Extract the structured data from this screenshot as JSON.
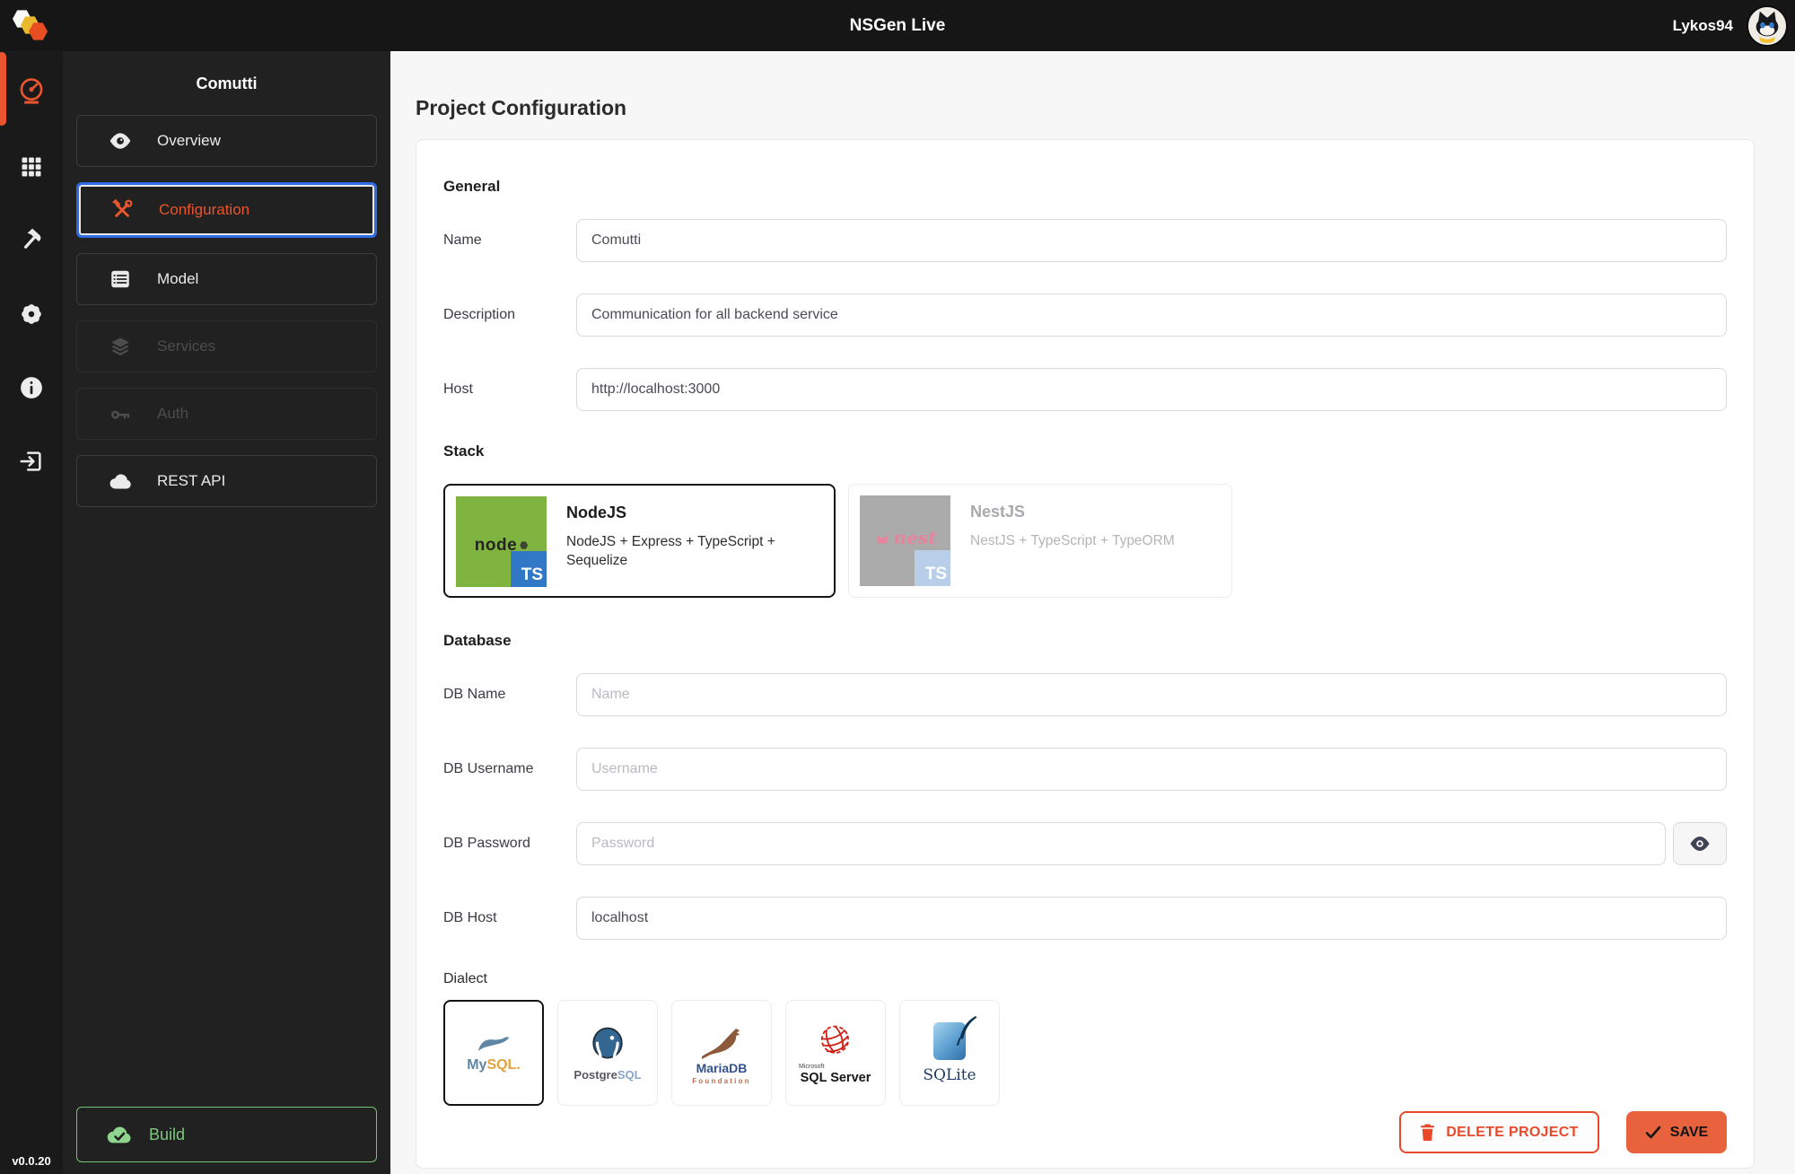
{
  "topbar": {
    "title": "NSGen Live",
    "username": "Lykos94"
  },
  "rail": {
    "version": "v0.0.20",
    "items": [
      {
        "icon": "speedometer",
        "active": true
      },
      {
        "icon": "grid",
        "active": false
      },
      {
        "icon": "hammer",
        "active": false
      },
      {
        "icon": "gear",
        "active": false
      },
      {
        "icon": "info",
        "active": false
      },
      {
        "icon": "sign-out",
        "active": false
      }
    ]
  },
  "sidebar": {
    "project_name": "Comutti",
    "items": [
      {
        "label": "Overview",
        "icon": "eye",
        "state": "normal"
      },
      {
        "label": "Configuration",
        "icon": "tools",
        "state": "active"
      },
      {
        "label": "Model",
        "icon": "list",
        "state": "normal"
      },
      {
        "label": "Services",
        "icon": "layers",
        "state": "disabled"
      },
      {
        "label": "Auth",
        "icon": "key",
        "state": "disabled"
      },
      {
        "label": "REST API",
        "icon": "cloud",
        "state": "normal"
      }
    ],
    "build_label": "Build"
  },
  "main": {
    "page_title": "Project Configuration",
    "sections": {
      "general": {
        "title": "General",
        "fields": [
          {
            "label": "Name",
            "value": "Comutti",
            "placeholder": ""
          },
          {
            "label": "Description",
            "value": "Communication for all backend service",
            "placeholder": ""
          },
          {
            "label": "Host",
            "value": "http://localhost:3000",
            "placeholder": ""
          }
        ]
      },
      "stack": {
        "title": "Stack",
        "options": [
          {
            "name": "NodeJS",
            "description": "NodeJS + Express + TypeScript + Sequelize",
            "logo_text": "node",
            "badge": "TS",
            "selected": true
          },
          {
            "name": "NestJS",
            "description": "NestJS + TypeScript + TypeORM",
            "logo_text": "nest",
            "badge": "TS",
            "selected": false
          }
        ]
      },
      "database": {
        "title": "Database",
        "fields": [
          {
            "label": "DB Name",
            "value": "",
            "placeholder": "Name"
          },
          {
            "label": "DB Username",
            "value": "",
            "placeholder": "Username"
          },
          {
            "label": "DB Password",
            "value": "",
            "placeholder": "Password"
          },
          {
            "label": "DB Host",
            "value": "localhost",
            "placeholder": ""
          }
        ],
        "dialect_label": "Dialect",
        "dialects": [
          {
            "name": "MySQL",
            "selected": true,
            "text_parts": [
              "My",
              "SQL."
            ]
          },
          {
            "name": "PostgreSQL",
            "selected": false,
            "text_parts": [
              "Postgre",
              "SQL"
            ]
          },
          {
            "name": "MariaDB Foundation",
            "selected": false,
            "text_parts": [
              "MariaDB",
              "Foundation"
            ]
          },
          {
            "name": "SQL Server",
            "selected": false,
            "text_parts": [
              "Microsoft",
              "SQL Server"
            ]
          },
          {
            "name": "SQLite",
            "selected": false,
            "text_parts": [
              "SQLite"
            ]
          }
        ]
      }
    },
    "actions": {
      "delete_label": "DELETE PROJECT",
      "save_label": "SAVE"
    }
  },
  "colors": {
    "accent_orange": "#e8552f",
    "save_orange": "#e8623e",
    "delete_red": "#e8492a",
    "build_green": "#74c274",
    "focus_blue": "#2e6be5",
    "ts_blue": "#3178c6",
    "node_green": "#7fb441"
  }
}
